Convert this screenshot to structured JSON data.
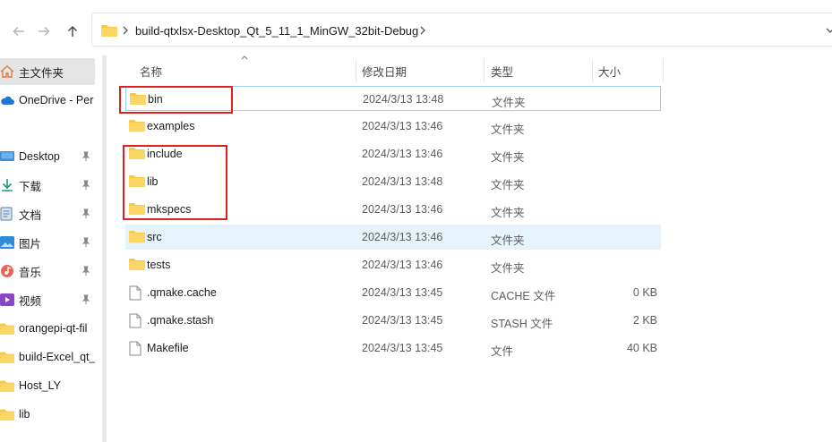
{
  "nav": {
    "back_icon": "arrow-left-icon",
    "forward_icon": "arrow-right-icon",
    "up_icon": "arrow-up-icon"
  },
  "address": {
    "path": "build-qtxlsx-Desktop_Qt_5_11_1_MinGW_32bit-Debug"
  },
  "sidebar": {
    "items": [
      {
        "label": "主文件夹",
        "icon": "home-icon"
      },
      {
        "label": "OneDrive - Per",
        "icon": "cloud-icon"
      },
      {
        "label": "Desktop",
        "icon": "desktop-icon"
      },
      {
        "label": "下载",
        "icon": "download-icon"
      },
      {
        "label": "文档",
        "icon": "document-icon"
      },
      {
        "label": "图片",
        "icon": "picture-icon"
      },
      {
        "label": "音乐",
        "icon": "music-icon"
      },
      {
        "label": "视频",
        "icon": "video-icon"
      },
      {
        "label": "orangepi-qt-fil",
        "icon": "folder-icon"
      },
      {
        "label": "build-Excel_qt_",
        "icon": "folder-icon"
      },
      {
        "label": "Host_LY",
        "icon": "folder-icon"
      },
      {
        "label": "lib",
        "icon": "folder-icon"
      }
    ]
  },
  "columns": {
    "name": "名称",
    "date": "修改日期",
    "type": "类型",
    "size": "大小"
  },
  "files": [
    {
      "name": "bin",
      "date": "2024/3/13 13:48",
      "type": "文件夹",
      "size": "",
      "icon": "folder-icon"
    },
    {
      "name": "examples",
      "date": "2024/3/13 13:46",
      "type": "文件夹",
      "size": "",
      "icon": "folder-icon"
    },
    {
      "name": "include",
      "date": "2024/3/13 13:46",
      "type": "文件夹",
      "size": "",
      "icon": "folder-icon"
    },
    {
      "name": "lib",
      "date": "2024/3/13 13:48",
      "type": "文件夹",
      "size": "",
      "icon": "folder-icon"
    },
    {
      "name": "mkspecs",
      "date": "2024/3/13 13:46",
      "type": "文件夹",
      "size": "",
      "icon": "folder-icon"
    },
    {
      "name": "src",
      "date": "2024/3/13 13:46",
      "type": "文件夹",
      "size": "",
      "icon": "folder-icon"
    },
    {
      "name": "tests",
      "date": "2024/3/13 13:46",
      "type": "文件夹",
      "size": "",
      "icon": "folder-icon"
    },
    {
      "name": ".qmake.cache",
      "date": "2024/3/13 13:45",
      "type": "CACHE 文件",
      "size": "0 KB",
      "icon": "file-icon"
    },
    {
      "name": ".qmake.stash",
      "date": "2024/3/13 13:45",
      "type": "STASH 文件",
      "size": "2 KB",
      "icon": "file-icon"
    },
    {
      "name": "Makefile",
      "date": "2024/3/13 13:45",
      "type": "文件",
      "size": "40 KB",
      "icon": "file-icon"
    }
  ],
  "colors": {
    "selection_bg": "#e5f3fb",
    "selection_border": "#99d1f7",
    "annotation": "#e0201c",
    "folder": "#f8c848"
  }
}
